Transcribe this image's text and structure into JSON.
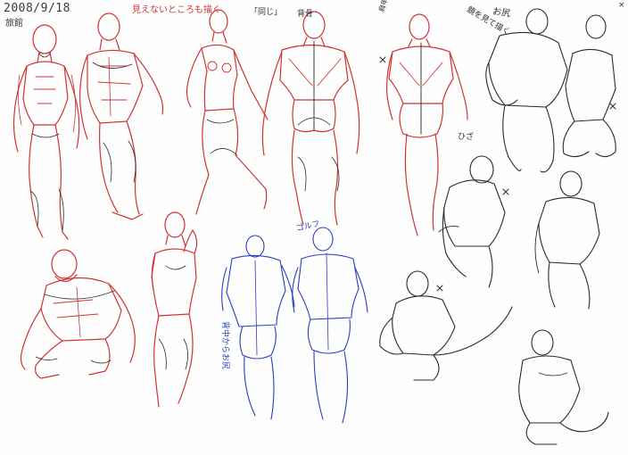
{
  "image": {
    "kind": "scanned sketchbook page",
    "palette": {
      "red_pencil": "#d23232",
      "black_ink": "#2a2a2a",
      "blue_pen": "#2a3fbf",
      "paper": "#fefefe"
    }
  },
  "annotations": {
    "date": "2008/9/18",
    "tabi": "旅館",
    "tsukurite": "見えないところも描く",
    "onaji": "「同じ」",
    "sebone": "背骨",
    "kata": "肩甲骨の動き",
    "kagami": "鏡を見て描く",
    "shiri": "お尻",
    "hiza": "ひざ",
    "kyo": "ゴルフ",
    "ushiro": "背中からお尻",
    "tsui": "×"
  }
}
